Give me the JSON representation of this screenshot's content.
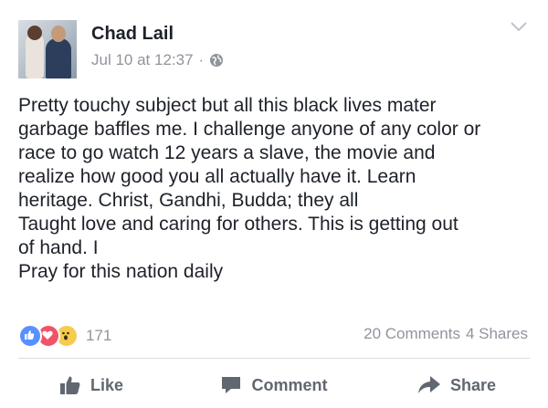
{
  "post": {
    "author": "Chad Lail",
    "timestamp": "Jul 10 at 12:37",
    "separator": "·",
    "privacy_icon": "globe-icon",
    "menu_icon": "chevron-down-icon",
    "body_lines": [
      "Pretty touchy subject but all this black lives mater",
      "garbage baffles me. I challenge anyone of any color or",
      "race to go watch 12 years a slave, the movie and",
      "realize how good you all actually have it. Learn",
      "heritage. Christ, Gandhi, Budda; they all",
      "Taught love and caring for others. This is getting out",
      "of hand. I",
      "Pray for this nation daily"
    ]
  },
  "reactions": {
    "types": [
      "like",
      "love",
      "wow"
    ],
    "count": "171",
    "comments": "20 Comments",
    "shares": "4 Shares"
  },
  "actions": {
    "like": "Like",
    "comment": "Comment",
    "share": "Share"
  },
  "colors": {
    "like_blue": "#5890ff",
    "love_red": "#f25268",
    "wow_yellow": "#f7cb4d",
    "secondary_text": "#90949c",
    "action_text": "#606770"
  }
}
